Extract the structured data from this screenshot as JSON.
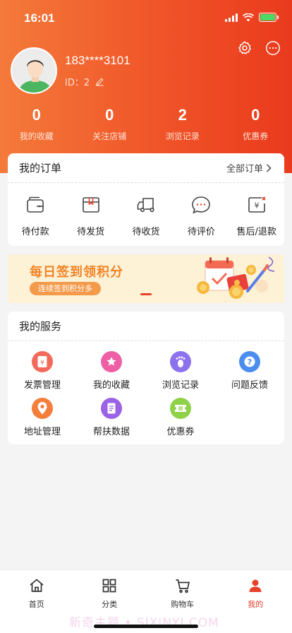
{
  "status_bar": {
    "time": "16:01"
  },
  "profile": {
    "phone": "183****3101",
    "id_text": "ID：2"
  },
  "stats": [
    {
      "value": "0",
      "label": "我的收藏"
    },
    {
      "value": "0",
      "label": "关注店铺"
    },
    {
      "value": "2",
      "label": "浏览记录"
    },
    {
      "value": "0",
      "label": "优惠券"
    }
  ],
  "orders": {
    "title": "我的订单",
    "more_label": "全部订单",
    "items": [
      {
        "label": "待付款",
        "icon": "wallet-icon"
      },
      {
        "label": "待发货",
        "icon": "package-icon"
      },
      {
        "label": "待收货",
        "icon": "truck-icon"
      },
      {
        "label": "待评价",
        "icon": "comment-icon"
      },
      {
        "label": "售后/退款",
        "icon": "refund-icon"
      }
    ]
  },
  "banner": {
    "title": "每日签到领积分",
    "subtitle": "连续签到积分多"
  },
  "services": {
    "title": "我的服务",
    "items": [
      {
        "label": "发票管理",
        "icon": "invoice-icon",
        "color": "#f26a5a"
      },
      {
        "label": "我的收藏",
        "icon": "star-icon",
        "color": "#ee5fa6"
      },
      {
        "label": "浏览记录",
        "icon": "footprint-icon",
        "color": "#8d72ee"
      },
      {
        "label": "问题反馈",
        "icon": "help-icon",
        "color": "#4c8df0"
      },
      {
        "label": "地址管理",
        "icon": "location-icon",
        "color": "#f57e3a"
      },
      {
        "label": "帮扶数据",
        "icon": "notebook-icon",
        "color": "#9a63e6"
      },
      {
        "label": "优惠券",
        "icon": "ticket-icon",
        "color": "#8fd24a"
      }
    ]
  },
  "tabbar": {
    "tabs": [
      {
        "label": "首页",
        "icon": "home-icon"
      },
      {
        "label": "分类",
        "icon": "grid-icon"
      },
      {
        "label": "购物车",
        "icon": "cart-icon"
      },
      {
        "label": "我的",
        "icon": "user-icon"
      }
    ],
    "active_color": "#e8412b"
  },
  "watermark": "新奇主题 • SIXINYI.COM",
  "colors": {
    "accent": "#e8412b",
    "hero_start": "#f47a3a",
    "hero_end": "#ea3a1d"
  }
}
